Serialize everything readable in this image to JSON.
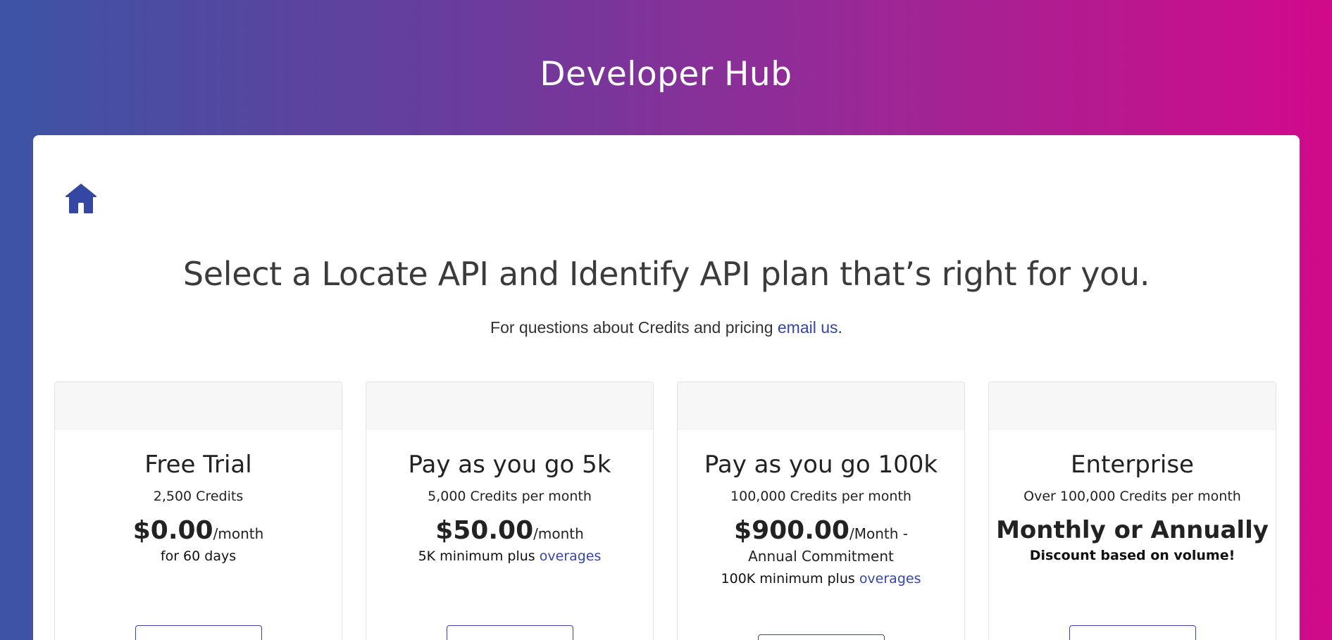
{
  "header": {
    "title": "Developer Hub"
  },
  "nav": {
    "home_icon": "home-icon"
  },
  "intro": {
    "heading": "Select a Locate API and Identify API plan that’s right for you.",
    "sub_text": "For questions about Credits and pricing ",
    "email_link": "email us",
    "sub_end": "."
  },
  "colors": {
    "gradient_start": "#3c54a5",
    "gradient_end": "#d20a8a",
    "link": "#3347a3",
    "home_icon": "#3347a3"
  },
  "plans": [
    {
      "title": "Free Trial",
      "credits": "2,500 Credits",
      "price": "$0.00",
      "period": "/month",
      "note": "for 60 days"
    },
    {
      "title": "Pay as you go 5k",
      "credits": "5,000 Credits per month",
      "price": "$50.00",
      "period": "/month",
      "note": "5K minimum plus ",
      "note_link": "overages"
    },
    {
      "title": "Pay as you go 100k",
      "credits": "100,000 Credits per month",
      "price": "$900.00",
      "period": "/Month - Annual Commitment",
      "note": "100K minimum plus ",
      "note_link": "overages"
    },
    {
      "title": "Enterprise",
      "credits": "Over 100,000 Credits per month",
      "headline": "Monthly or Annually",
      "note": "Discount based on volume!"
    }
  ]
}
